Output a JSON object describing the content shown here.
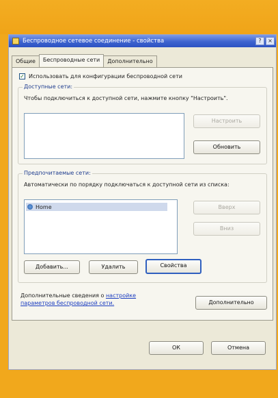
{
  "window": {
    "title": "Беспроводное сетевое соединение - свойства",
    "help_button": "?",
    "close_button": "×"
  },
  "tabs": [
    {
      "label": "Общие"
    },
    {
      "label": "Беспроводные сети"
    },
    {
      "label": "Дополнительно"
    }
  ],
  "wireless": {
    "use_windows_label": "Использовать для конфигурации беспроводной сети",
    "use_windows_checked": true
  },
  "available": {
    "title": "Доступные сети:",
    "description": "Чтобы подключиться к доступной сети, нажмите кнопку \"Настроить\".",
    "configure_button": "Настроить",
    "refresh_button": "Обновить"
  },
  "preferred": {
    "title": "Предпочитаемые сети:",
    "description": "Автоматически по порядку подключаться к доступной сети из списка:",
    "items": [
      {
        "name": "Home"
      }
    ],
    "up_button": "Вверх",
    "down_button": "Вниз",
    "add_button": "Добавить...",
    "remove_button": "Удалить",
    "properties_button": "Свойства"
  },
  "info": {
    "text": "Дополнительные сведения о",
    "link": "настройке параметров беспроводной сети.",
    "advanced_button": "Дополнительно"
  },
  "footer": {
    "ok_button": "ОК",
    "cancel_button": "Отмена"
  }
}
